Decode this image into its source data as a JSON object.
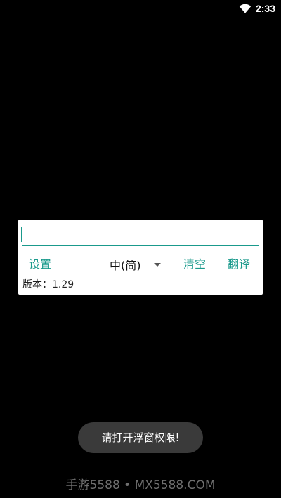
{
  "status_bar": {
    "time": "2:33",
    "wifi_icon": "wifi-icon"
  },
  "translator": {
    "input_value": "",
    "settings_label": "设置",
    "language_selected": "中(简)",
    "clear_label": "清空",
    "translate_label": "翻译",
    "version_text": "版本：1.29"
  },
  "toast": {
    "message": "请打开浮窗权限!"
  },
  "watermark": {
    "text": "手游5588 • MX5588.COM"
  },
  "colors": {
    "accent": "#1a9a8c",
    "background": "#000000",
    "panel": "#ffffff",
    "toast": "#3a3a3a"
  }
}
